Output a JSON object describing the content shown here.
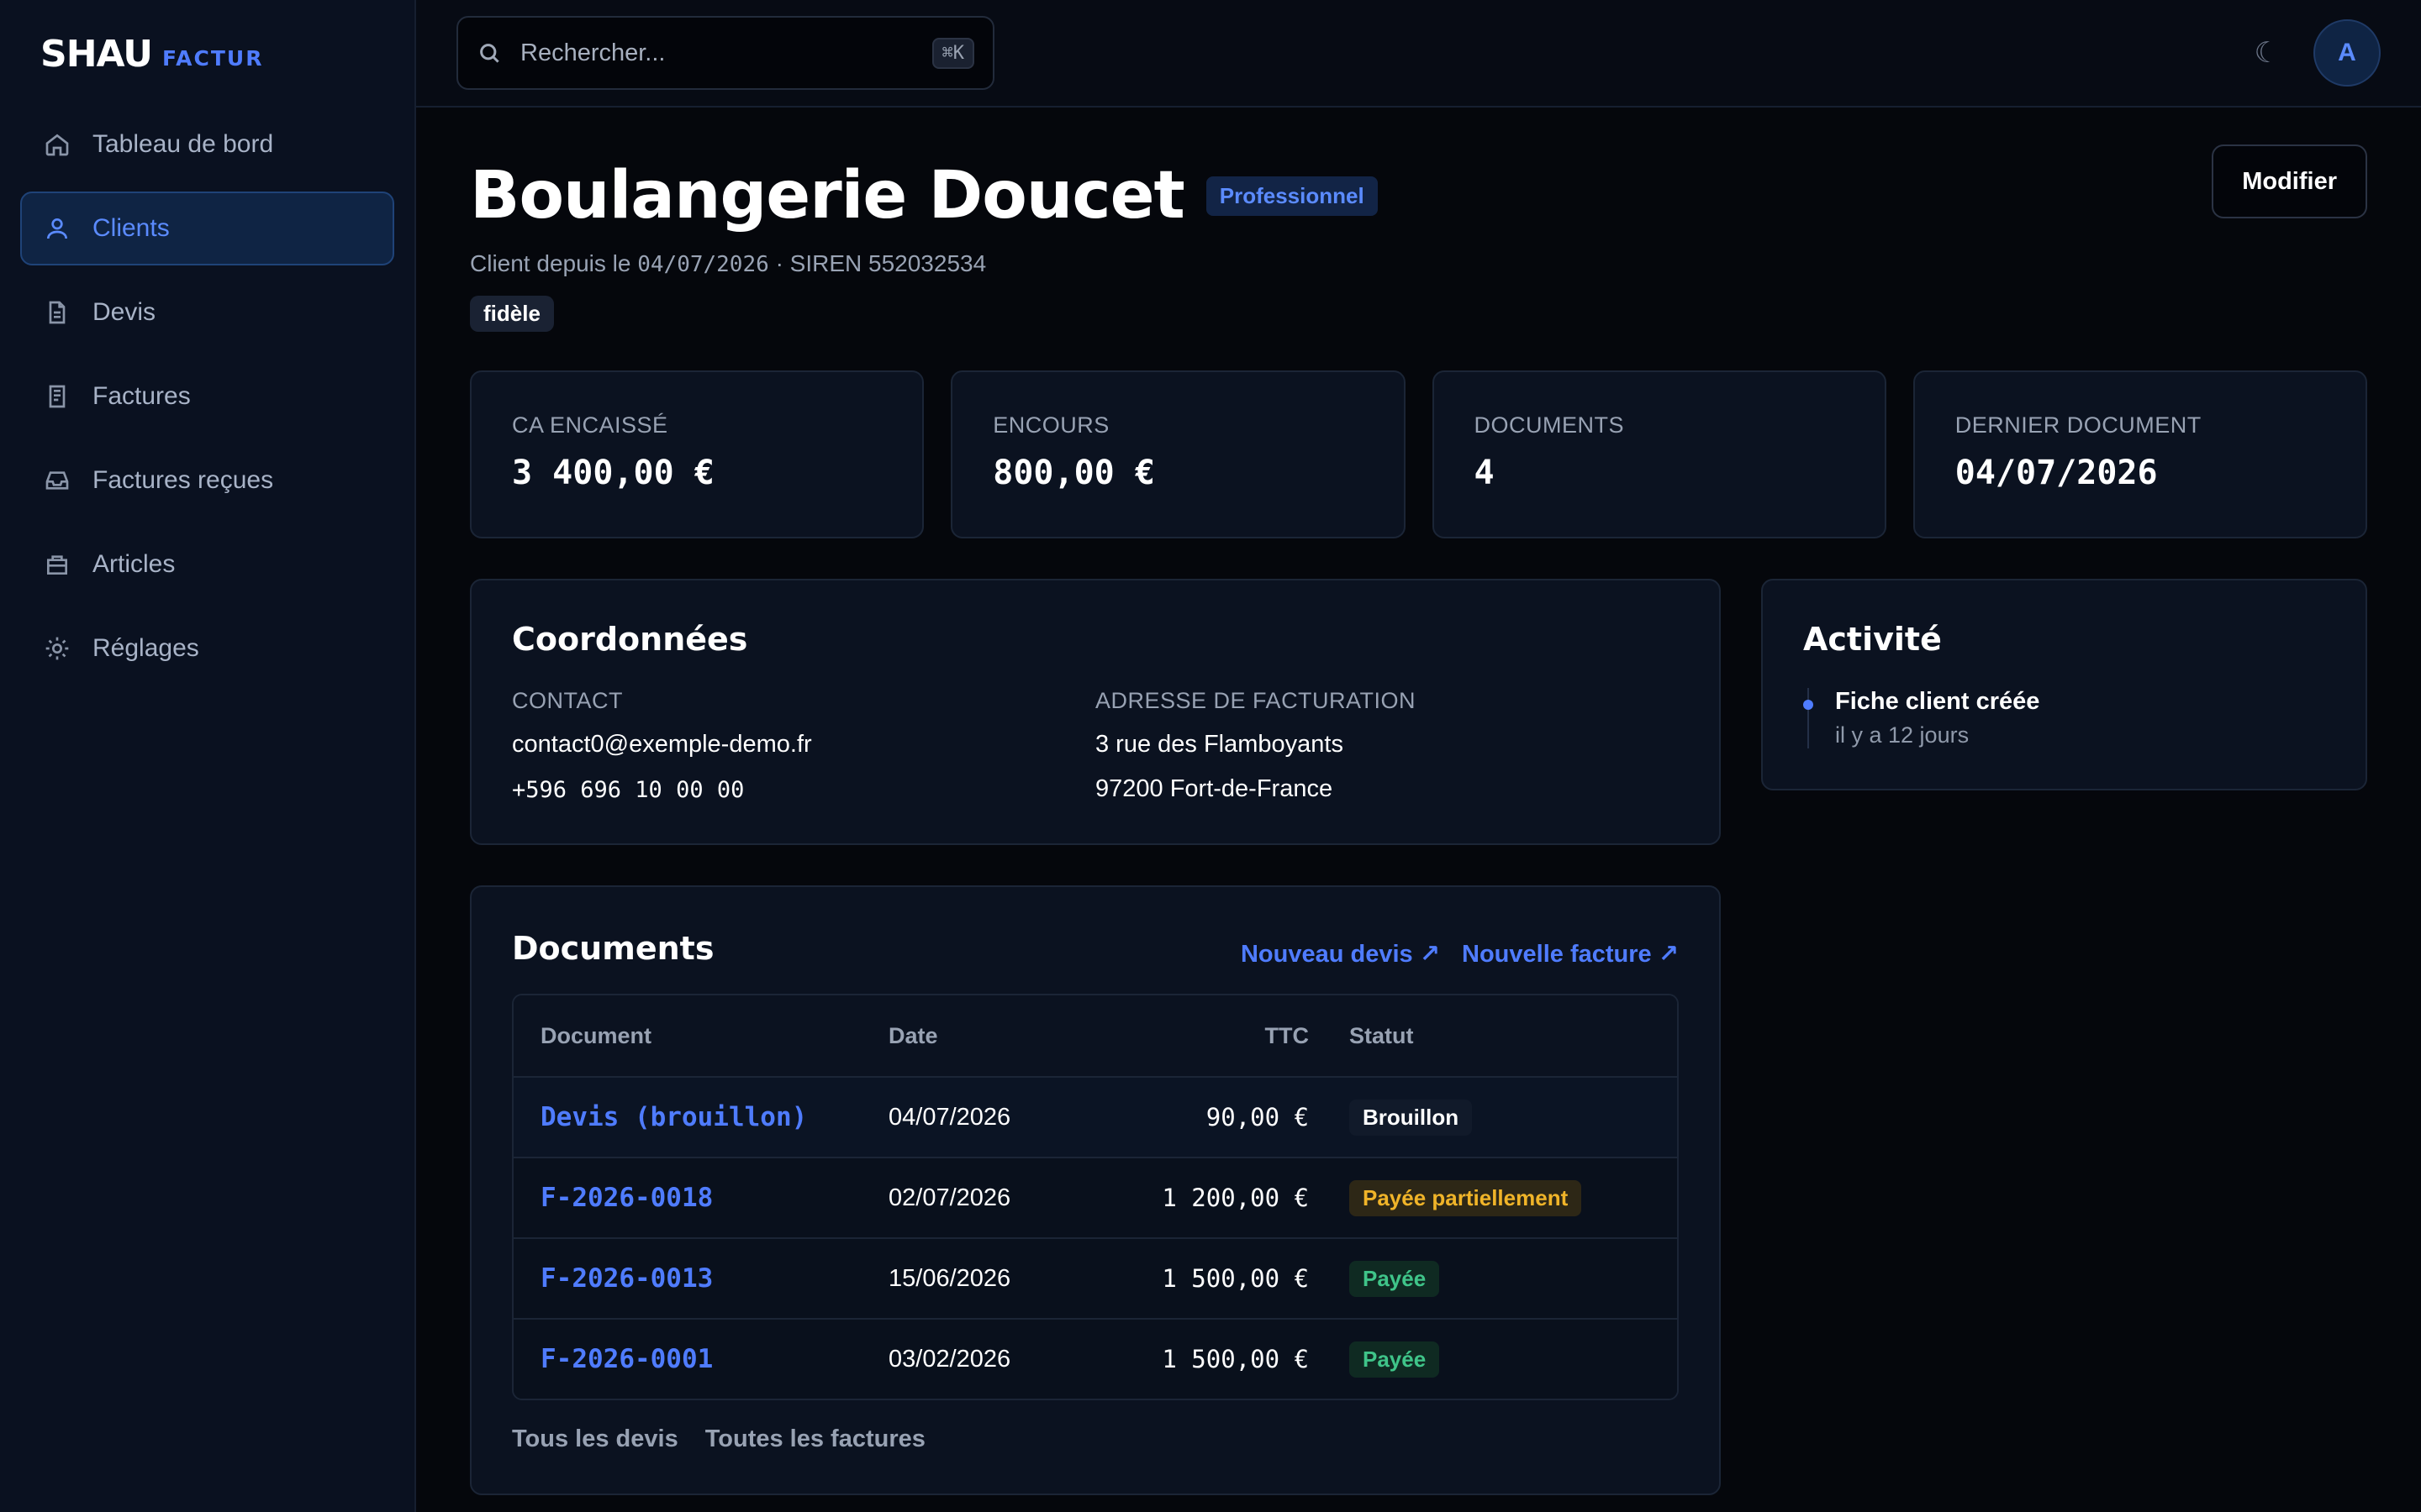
{
  "brand": {
    "main": "SHAU",
    "sub": "FACTUR"
  },
  "sidebar": {
    "items": [
      {
        "label": "Tableau de bord",
        "icon": "home-icon"
      },
      {
        "label": "Clients",
        "icon": "user-icon",
        "active": true
      },
      {
        "label": "Devis",
        "icon": "document-icon"
      },
      {
        "label": "Factures",
        "icon": "receipt-icon"
      },
      {
        "label": "Factures reçues",
        "icon": "inbox-icon"
      },
      {
        "label": "Articles",
        "icon": "box-icon"
      },
      {
        "label": "Réglages",
        "icon": "gear-icon"
      }
    ]
  },
  "topbar": {
    "search_placeholder": "Rechercher...",
    "shortcut": "⌘K",
    "theme_icon": "☾",
    "avatar_initial": "A"
  },
  "client": {
    "name": "Boulangerie Doucet",
    "type_badge": "Professionnel",
    "since_prefix": "Client depuis le",
    "since_date": "04/07/2026",
    "siren_text": "· SIREN 552032534",
    "tag": "fidèle",
    "edit_label": "Modifier"
  },
  "stats": [
    {
      "label": "CA ENCAISSÉ",
      "value": "3 400,00 €"
    },
    {
      "label": "ENCOURS",
      "value": "800,00 €"
    },
    {
      "label": "DOCUMENTS",
      "value": "4"
    },
    {
      "label": "DERNIER DOCUMENT",
      "value": "04/07/2026"
    }
  ],
  "coordonnees": {
    "title": "Coordonnées",
    "contact_label": "CONTACT",
    "email": "contact0@exemple-demo.fr",
    "phone": "+596 696 10 00 00",
    "address_label": "ADRESSE DE FACTURATION",
    "address_line1": "3 rue des Flamboyants",
    "address_line2": "97200 Fort-de-France"
  },
  "activity": {
    "title": "Activité",
    "items": [
      {
        "title": "Fiche client créée",
        "time": "il y a 12 jours"
      }
    ]
  },
  "documents": {
    "title": "Documents",
    "new_quote": "Nouveau devis ↗",
    "new_invoice": "Nouvelle facture ↗",
    "columns": [
      "Document",
      "Date",
      "TTC",
      "Statut"
    ],
    "rows": [
      {
        "id": "Devis (brouillon)",
        "date": "04/07/2026",
        "ttc": "90,00 €",
        "status": "Brouillon",
        "status_kind": "draft"
      },
      {
        "id": "F-2026-0018",
        "date": "02/07/2026",
        "ttc": "1 200,00 €",
        "status": "Payée partiellement",
        "status_kind": "partial"
      },
      {
        "id": "F-2026-0013",
        "date": "15/06/2026",
        "ttc": "1 500,00 €",
        "status": "Payée",
        "status_kind": "paid"
      },
      {
        "id": "F-2026-0001",
        "date": "03/02/2026",
        "ttc": "1 500,00 €",
        "status": "Payée",
        "status_kind": "paid"
      }
    ],
    "all_quotes": "Tous les devis",
    "all_invoices": "Toutes les factures"
  },
  "colors": {
    "accent": "#4f7cff",
    "warning": "#f0b429",
    "success": "#3fc489"
  }
}
